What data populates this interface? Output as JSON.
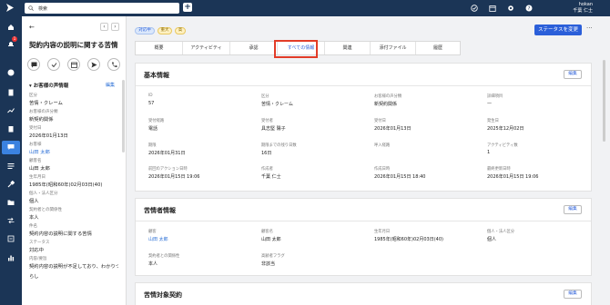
{
  "topbar": {
    "search_placeholder": "検索",
    "user_name": "hokan",
    "user_fullname": "千葉 仁士",
    "icons": [
      "check-circle-icon",
      "calendar-icon",
      "gear-icon",
      "help-icon"
    ]
  },
  "rail": {
    "badge": "1",
    "icons": [
      "home-icon",
      "bell-icon",
      "person-icon",
      "document-icon",
      "chart-icon",
      "clipboard-icon",
      "chat-icon",
      "list-icon",
      "gavel-icon",
      "folder-icon",
      "arrows-icon",
      "settings-icon",
      "bar-chart-icon"
    ]
  },
  "left_panel": {
    "title": "契約内容の説明に関する苦情",
    "section_title": "お客様の声情報",
    "edit_label": "編集",
    "fields": [
      {
        "label": "区分",
        "value": "苦情・クレーム",
        "link": false
      },
      {
        "label": "お客様の声分類",
        "value": "新契約関係",
        "link": false
      },
      {
        "label": "受付日",
        "value": "2026年01月13日",
        "link": false
      },
      {
        "label": "お客様",
        "value": "山田 太郎",
        "link": true
      },
      {
        "label": "顧客名",
        "value": "山田 太郎",
        "link": false
      },
      {
        "label": "生年月日",
        "value": "1985年(昭和60年)02月03日(40)",
        "link": false
      },
      {
        "label": "個人・法人区分",
        "value": "個人",
        "link": false
      },
      {
        "label": "契約者との関係性",
        "value": "本人",
        "link": false
      },
      {
        "label": "件名",
        "value": "契約内容の説明に関する苦情",
        "link": false
      },
      {
        "label": "ステータス",
        "value": "対応中",
        "link": false
      },
      {
        "label": "内容/要旨",
        "value": "契約内容の説明が不足しており、わかりづ",
        "link": false
      },
      {
        "label": "",
        "value": "らし",
        "link": false
      }
    ]
  },
  "main": {
    "tags": [
      {
        "text": "対応中",
        "bg": "#dbe8fb",
        "fg": "#2b5fd9",
        "border": "#a9c3f0"
      },
      {
        "text": "重大",
        "bg": "#fff1c2",
        "fg": "#8a6a00",
        "border": "#e8c860"
      },
      {
        "text": "高",
        "bg": "#fff1c2",
        "fg": "#8a6a00",
        "border": "#e8c860"
      }
    ],
    "status_button": "ステータスを変更",
    "more": "···",
    "tabs": [
      "概要",
      "アクティビティ",
      "承認",
      "すべての情報",
      "関連",
      "添付ファイル",
      "履歴"
    ],
    "selected_tab": 3,
    "edit_label": "編集",
    "basic": {
      "title": "基本情報",
      "fields": [
        {
          "label": "ID",
          "value": "57"
        },
        {
          "label": "区分",
          "value": "苦情・クレーム"
        },
        {
          "label": "お客様の声分類",
          "value": "新契約関係"
        },
        {
          "label": "詳細項目",
          "value": "—"
        },
        {
          "label": "受付経路",
          "value": "電話"
        },
        {
          "label": "受付者",
          "value": "具志堅 陽子"
        },
        {
          "label": "受付日",
          "value": "2026年01月13日"
        },
        {
          "label": "発生日",
          "value": "2025年12月02日"
        },
        {
          "label": "期限",
          "value": "2026年01月31日"
        },
        {
          "label": "期限までの残り日数",
          "value": "16日"
        },
        {
          "label": "呼入経路",
          "value": ""
        },
        {
          "label": "アクティビティ数",
          "value": "1"
        },
        {
          "label": "前回のアクション日時",
          "value": "2026年01月15日 19:06"
        },
        {
          "label": "作成者",
          "value": "千葉 仁士"
        },
        {
          "label": "作成日時",
          "value": "2026年01月15日 18:40"
        },
        {
          "label": "最終更新日時",
          "value": "2026年01月15日 19:06"
        }
      ]
    },
    "complainant": {
      "title": "苦情者情報",
      "fields": [
        {
          "label": "顧客",
          "value": "山田 太郎",
          "link": true
        },
        {
          "label": "顧客名",
          "value": "山田 太郎",
          "link": false
        },
        {
          "label": "生年月日",
          "value": "1985年(昭和60年)02月03日(40)",
          "link": false
        },
        {
          "label": "個人・法人区分",
          "value": "個人",
          "link": false
        },
        {
          "label": "契約者との関係性",
          "value": "本人",
          "link": false
        },
        {
          "label": "高齢者フラグ",
          "value": "非該当",
          "link": false
        }
      ]
    },
    "contract": {
      "title": "苦情対象契約",
      "headers": [
        "契約",
        "証券番号",
        "保険会社",
        "保険種類",
        "種目"
      ]
    }
  }
}
